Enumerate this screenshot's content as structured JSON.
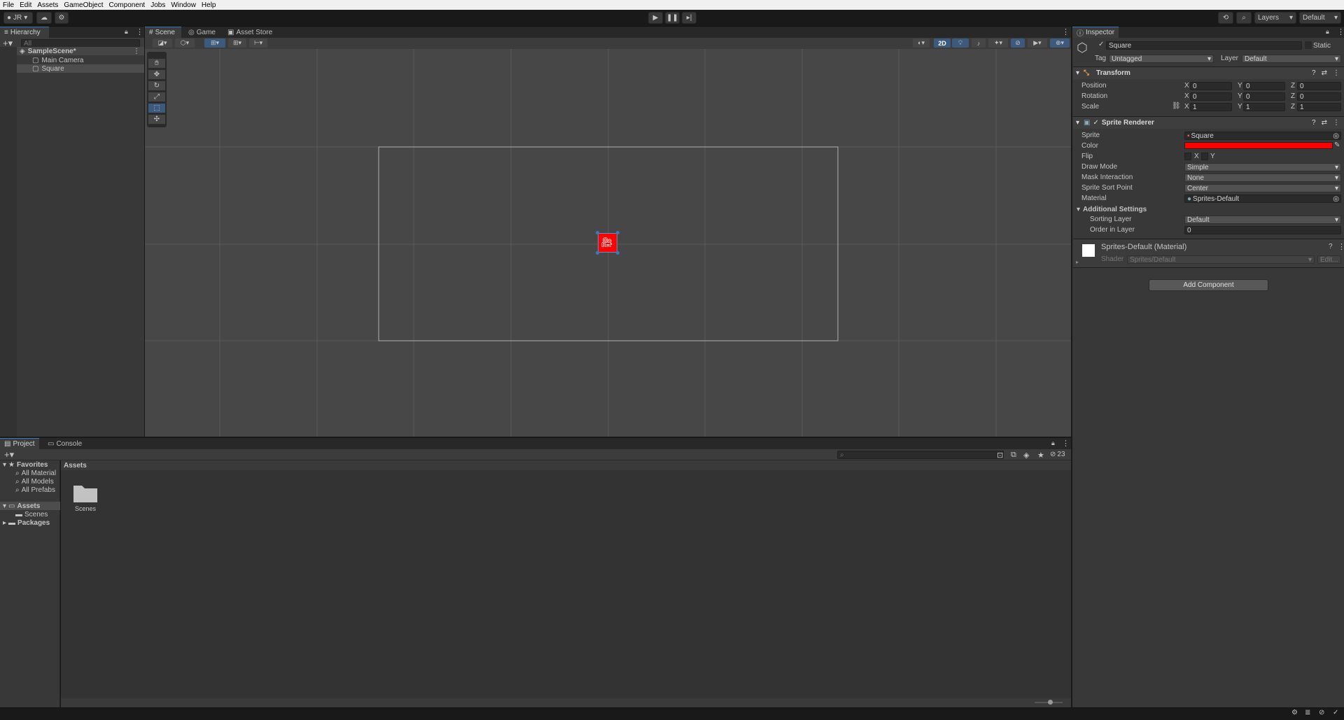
{
  "menu": [
    "File",
    "Edit",
    "Assets",
    "GameObject",
    "Component",
    "Jobs",
    "Window",
    "Help"
  ],
  "toolbar": {
    "account": "JR",
    "layers": "Layers",
    "layout": "Default"
  },
  "hierarchy": {
    "title": "Hierarchy",
    "search_placeholder": "All",
    "scene": "SampleScene*",
    "items": [
      "Main Camera",
      "Square"
    ]
  },
  "scene_tabs": [
    "Scene",
    "Game",
    "Asset Store"
  ],
  "scene_view": {
    "mode_2d": "2D"
  },
  "inspector": {
    "title": "Inspector",
    "object_name": "Square",
    "static_label": "Static",
    "tag_label": "Tag",
    "tag_value": "Untagged",
    "layer_label": "Layer",
    "layer_value": "Default",
    "transform": {
      "title": "Transform",
      "position": {
        "label": "Position",
        "x": "0",
        "y": "0",
        "z": "0"
      },
      "rotation": {
        "label": "Rotation",
        "x": "0",
        "y": "0",
        "z": "0"
      },
      "scale": {
        "label": "Scale",
        "x": "1",
        "y": "1",
        "z": "1"
      },
      "axis_x": "X",
      "axis_y": "Y",
      "axis_z": "Z"
    },
    "sprite_renderer": {
      "title": "Sprite Renderer",
      "sprite_label": "Sprite",
      "sprite_value": "Square",
      "color_label": "Color",
      "color_value": "#ff0000",
      "flip_label": "Flip",
      "flip_x": "X",
      "flip_y": "Y",
      "draw_mode_label": "Draw Mode",
      "draw_mode_value": "Simple",
      "mask_label": "Mask Interaction",
      "mask_value": "None",
      "sort_point_label": "Sprite Sort Point",
      "sort_point_value": "Center",
      "material_label": "Material",
      "material_value": "Sprites-Default",
      "additional": "Additional Settings",
      "sorting_layer_label": "Sorting Layer",
      "sorting_layer_value": "Default",
      "order_label": "Order in Layer",
      "order_value": "0"
    },
    "material": {
      "title": "Sprites-Default (Material)",
      "shader_label": "Shader",
      "shader_value": "Sprites/Default",
      "edit_label": "Edit..."
    },
    "add_component": "Add Component"
  },
  "project": {
    "tabs": [
      "Project",
      "Console"
    ],
    "favorites": "Favorites",
    "favorite_items": [
      "All Material",
      "All Models",
      "All Prefabs"
    ],
    "assets": "Assets",
    "asset_children": [
      "Scenes"
    ],
    "packages": "Packages",
    "breadcrumb": "Assets",
    "folder": "Scenes",
    "hidden_count": "23"
  },
  "colors": {
    "accent": "#3a79bb",
    "square": "#ff0000",
    "selection": "#2c5d87"
  }
}
